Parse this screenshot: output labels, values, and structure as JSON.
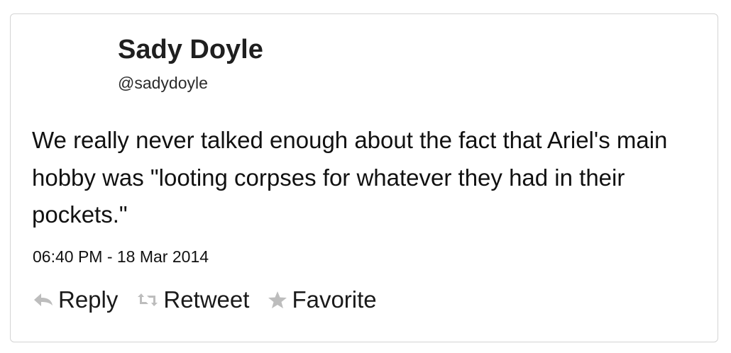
{
  "tweet": {
    "author": {
      "display_name": "Sady Doyle",
      "handle": "@sadydoyle"
    },
    "text": "We really never talked enough about the fact that Ariel's main hobby was \"looting corpses for whatever they had in their pockets.\"",
    "timestamp": "06:40 PM - 18 Mar 2014",
    "actions": {
      "reply": {
        "label": "Reply",
        "icon": "reply-icon"
      },
      "retweet": {
        "label": "Retweet",
        "icon": "retweet-icon"
      },
      "favorite": {
        "label": "Favorite",
        "icon": "star-icon"
      }
    },
    "colors": {
      "border": "#d4d4d4",
      "icon": "#bdbdbd",
      "text": "#111111"
    }
  }
}
